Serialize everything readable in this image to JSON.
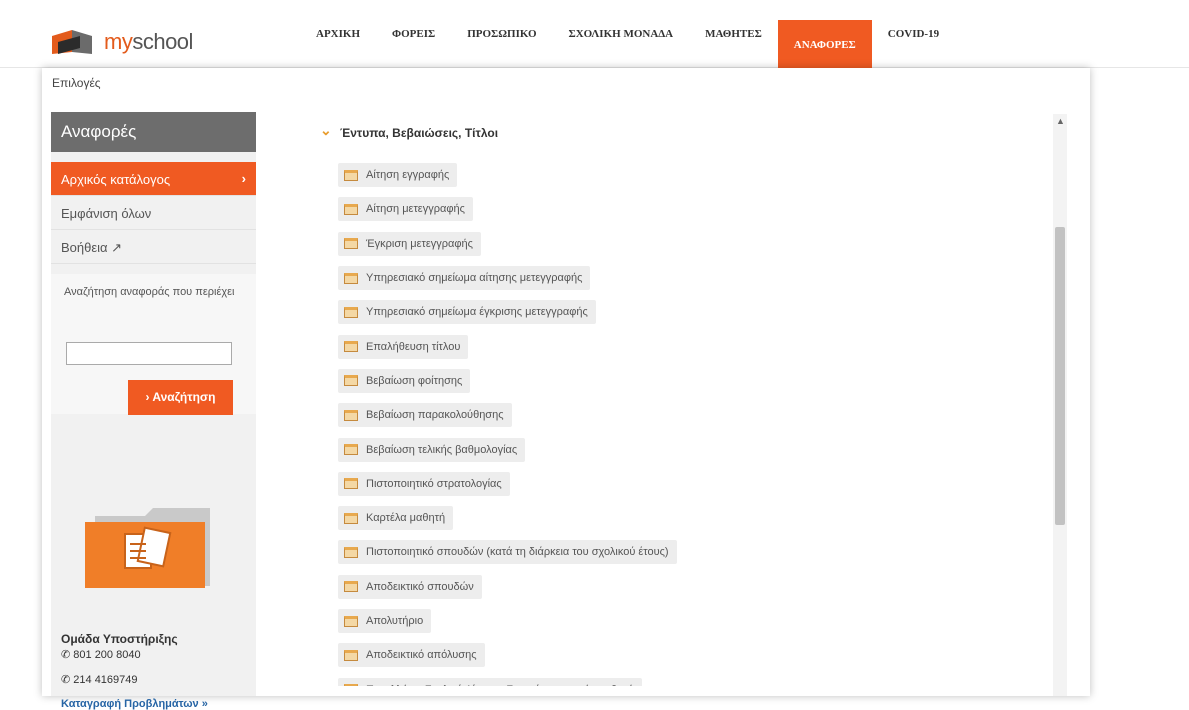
{
  "brand": {
    "name_my": "my",
    "name_school": "school"
  },
  "nav": [
    {
      "label": "ΑΡΧΙΚΗ",
      "active": false
    },
    {
      "label": "ΦΟΡΕΙΣ",
      "active": false
    },
    {
      "label": "ΠΡΟΣΩΠΙΚΟ",
      "active": false
    },
    {
      "label": "ΣΧΟΛΙΚΗ ΜΟΝΑΔΑ",
      "active": false
    },
    {
      "label": "ΜΑΘΗΤΕΣ",
      "active": false
    },
    {
      "label": "ΑΝΑΦΟΡΕΣ",
      "active": true
    },
    {
      "label": "COVID-19",
      "active": false
    }
  ],
  "breadcrumb": "Επιλογές",
  "sidebar": {
    "title": "Αναφορές",
    "items": [
      {
        "label": "Αρχικός κατάλογος",
        "active": true
      },
      {
        "label": "Εμφάνιση όλων",
        "active": false
      },
      {
        "label": "Βοήθεια ↗",
        "active": false
      }
    ],
    "search_label": "Αναζήτηση αναφοράς που περιέχει",
    "search_value": "",
    "search_button": "› Αναζήτηση"
  },
  "support": {
    "title": "Ομάδα Υποστήριξης",
    "phone1": "801 200 8040",
    "phone2": "214 4169749",
    "report_link": "Καταγραφή Προβλημάτων »"
  },
  "section": {
    "title": "Έντυπα, Βεβαιώσεις, Τίτλοι",
    "reports": [
      "Αίτηση εγγραφής",
      "Αίτηση μετεγγραφής",
      "Έγκριση μετεγγραφής",
      "Υπηρεσιακό σημείωμα αίτησης μετεγγραφής",
      "Υπηρεσιακό σημείωμα έγκρισης μετεγγραφής",
      "Επαλήθευση τίτλου",
      "Βεβαίωση φοίτησης",
      "Βεβαίωση παρακολούθησης",
      "Βεβαίωση τελικής βαθμολογίας",
      "Πιστοποιητικό στρατολογίας",
      "Καρτέλα μαθητή",
      "Πιστοποιητικό σπουδών (κατά τη διάρκεια του σχολικού έτους)",
      "Αποδεικτικό σπουδών",
      "Απολυτήριο",
      "Αποδεικτικό απόλυσης",
      "Πανελλήνιο Σχολικό Δίκτυο - Στοιχεία εγγραφής μαθητή"
    ]
  },
  "colors": {
    "accent": "#f05a22",
    "link": "#2765a5",
    "sidebar_title_bg": "#6d6d6d"
  }
}
